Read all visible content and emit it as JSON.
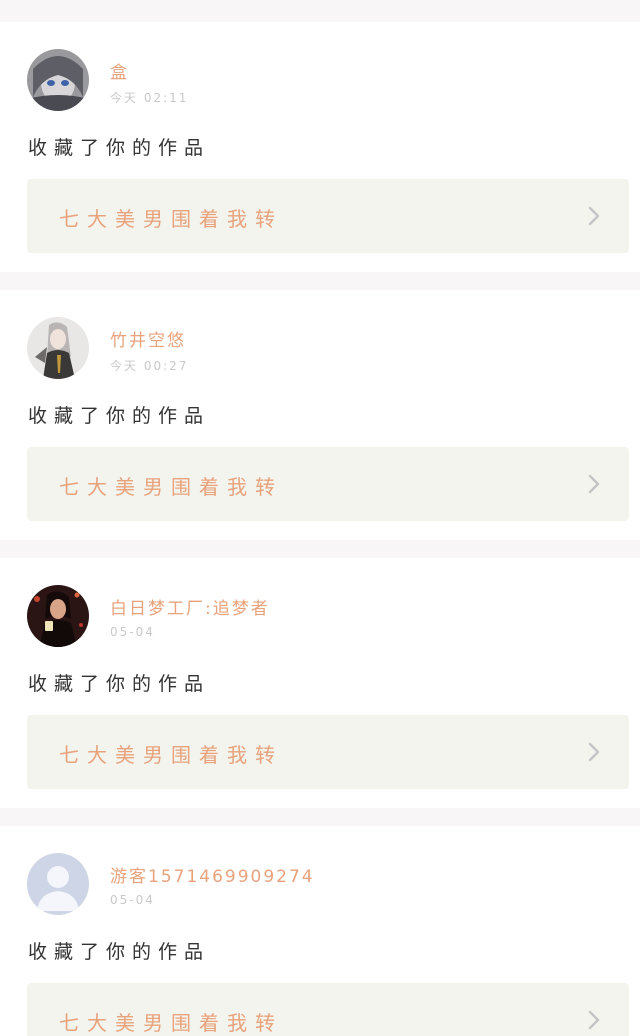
{
  "colors": {
    "accent": "#e8a27c",
    "text": "#333333",
    "muted": "#c9c9c9",
    "card_box": "#f4f4ee",
    "separator": "#f8f6f7"
  },
  "notifications": [
    {
      "username": "盒",
      "time": "今天 02:11",
      "action": "收藏了你的作品",
      "work_title": "七大美男围着我转",
      "avatar_icon": "anime-girl-avatar-icon"
    },
    {
      "username": "竹井空悠",
      "time": "今天 00:27",
      "action": "收藏了你的作品",
      "work_title": "七大美男围着我转",
      "avatar_icon": "anime-character-avatar-icon"
    },
    {
      "username": "白日梦工厂:追梦者",
      "time": "05-04",
      "action": "收藏了你的作品",
      "work_title": "七大美男围着我转",
      "avatar_icon": "woman-photo-avatar-icon"
    },
    {
      "username": "游客1571469909274",
      "time": "05-04",
      "action": "收藏了你的作品",
      "work_title": "七大美男围着我转",
      "avatar_icon": "default-user-avatar-icon"
    }
  ]
}
